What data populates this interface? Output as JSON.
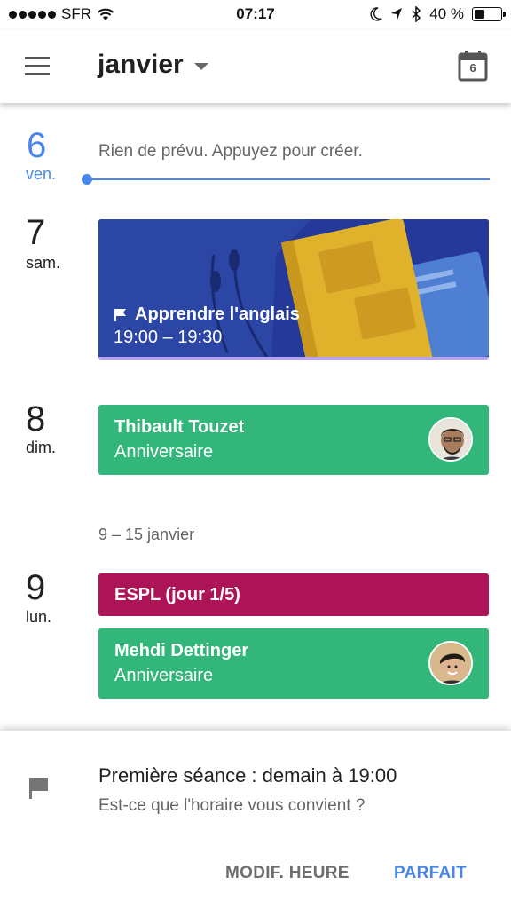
{
  "status_bar": {
    "carrier": "SFR",
    "time": "07:17",
    "battery_pct": "40 %",
    "battery_level": 0.4
  },
  "app_bar": {
    "month": "janvier",
    "calendar_icon_day": "6"
  },
  "days": [
    {
      "num": "6",
      "name": "ven.",
      "empty_text": "Rien de prévu. Appuyez pour créer."
    },
    {
      "num": "7",
      "name": "sam."
    },
    {
      "num": "8",
      "name": "dim."
    },
    {
      "num": "9",
      "name": "lun."
    }
  ],
  "events": {
    "goal": {
      "title": "Apprendre l'anglais",
      "time": "19:00 – 19:30",
      "icon": "flag-icon"
    },
    "birthday_1": {
      "title": "Thibault Touzet",
      "subtitle": "Anniversaire"
    },
    "espl": {
      "title": "ESPL (jour 1/5)"
    },
    "birthday_2": {
      "title": "Mehdi Dettinger",
      "subtitle": "Anniversaire"
    }
  },
  "week_range": "9 – 15 janvier",
  "snackbar": {
    "title": "Première séance : demain à 19:00",
    "subtitle": "Est-ce que l'horaire vous convient ?",
    "btn_modify": "MODIF. HEURE",
    "btn_ok": "PARFAIT"
  },
  "colors": {
    "accent": "#4a86e8",
    "birthday": "#33b679",
    "espl": "#ad1457",
    "goal_banner": "#2c46a5"
  }
}
